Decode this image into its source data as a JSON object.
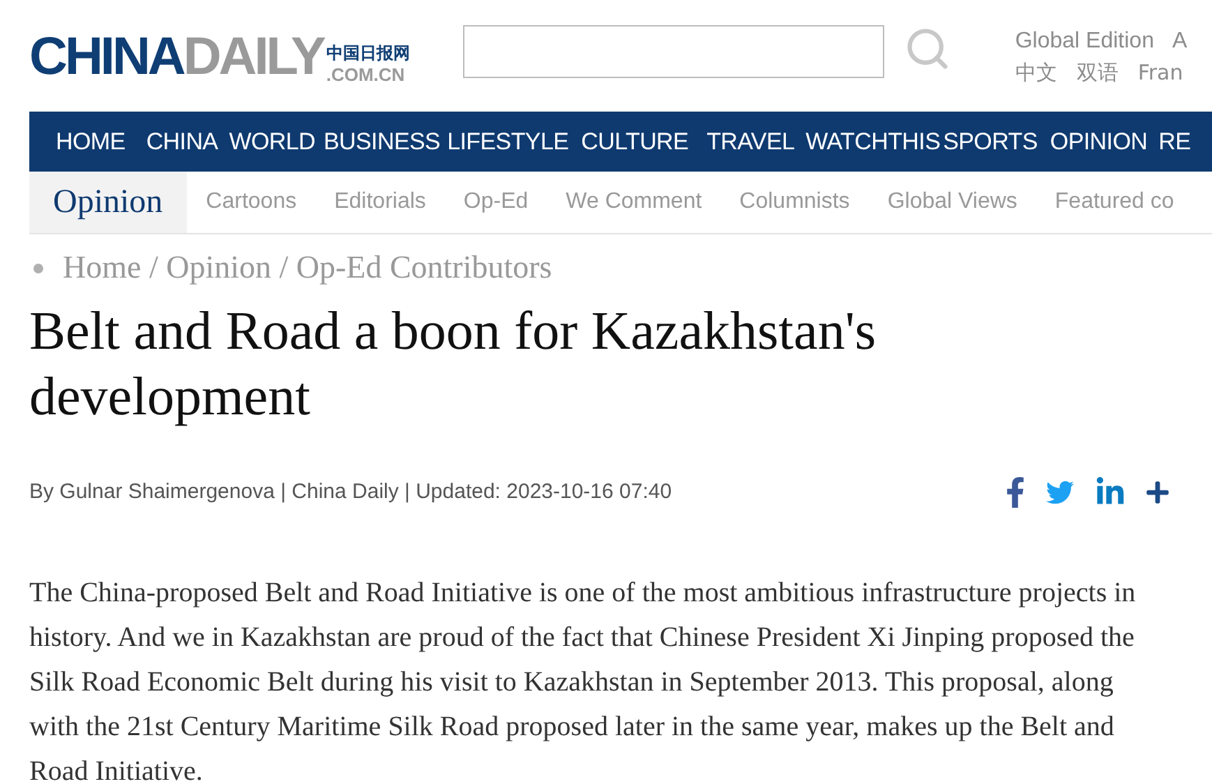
{
  "logo": {
    "china": "CHINA",
    "daily": "DAILY",
    "chinese": "中国日报网",
    "domain": ".COM.CN"
  },
  "editions": {
    "top": [
      "Global Edition",
      "A"
    ],
    "bottom": [
      "中文",
      "双语",
      "Fran"
    ]
  },
  "nav": [
    "HOME",
    "CHINA",
    "WORLD",
    "BUSINESS",
    "LIFESTYLE",
    "CULTURE",
    "TRAVEL",
    "WATCHTHIS",
    "SPORTS",
    "OPINION",
    "RE"
  ],
  "subnav": [
    {
      "label": "Opinion",
      "selected": true
    },
    {
      "label": "Cartoons",
      "selected": false
    },
    {
      "label": "Editorials",
      "selected": false
    },
    {
      "label": "Op-Ed",
      "selected": false
    },
    {
      "label": "We Comment",
      "selected": false
    },
    {
      "label": "Columnists",
      "selected": false
    },
    {
      "label": "Global Views",
      "selected": false
    },
    {
      "label": "Featured co",
      "selected": false
    }
  ],
  "breadcrumb": "Home / Opinion / Op-Ed Contributors",
  "headline": "Belt and Road a boon for Kazakhstan's development",
  "byline": "By Gulnar Shaimergenova | China Daily | Updated: 2023-10-16 07:40",
  "share": [
    {
      "kind": "facebook"
    },
    {
      "kind": "twitter"
    },
    {
      "kind": "linkedin"
    },
    {
      "kind": "more"
    }
  ],
  "body": "The China-proposed Belt and Road Initiative is one of the most ambitious infrastructure projects in history. And we in Kazakhstan are proud of the fact that Chinese President Xi Jinping proposed the Silk Road Economic Belt during his visit to Kazakhstan in September 2013. This proposal, along with the 21st Century Maritime Silk Road proposed later in the same year, makes up the Belt and Road Initiative."
}
